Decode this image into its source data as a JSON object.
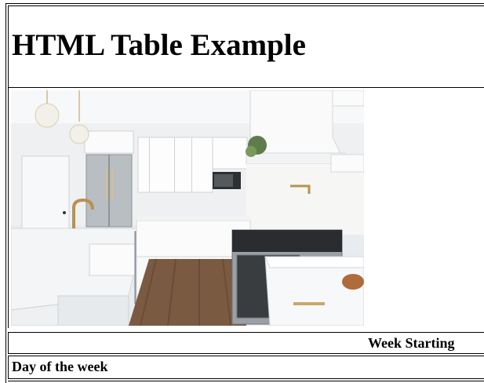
{
  "page": {
    "title": "HTML Table Example"
  },
  "image": {
    "alt": "kitchen"
  },
  "table": {
    "week_header": "Week Starting",
    "day_header": "Day of the week"
  }
}
